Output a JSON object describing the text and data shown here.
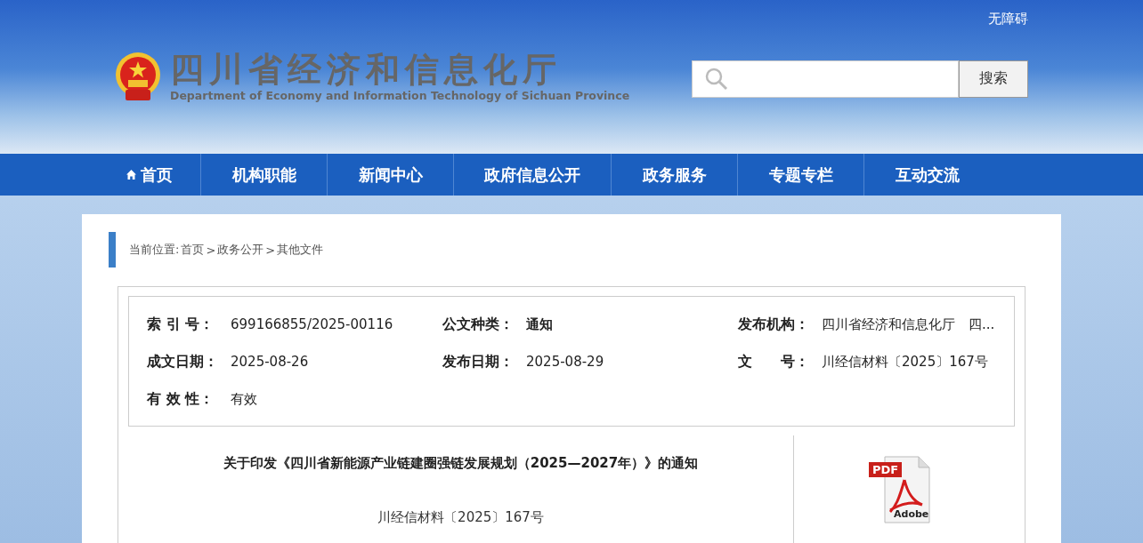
{
  "header": {
    "accessibility_link": "无障碍",
    "site_title": "四川省经济和信息化厅",
    "site_subtitle": "Department of Economy and Information Technology of Sichuan Province",
    "search": {
      "button": "搜索"
    }
  },
  "nav": [
    {
      "label": "首页",
      "kind": "home"
    },
    {
      "label": "机构职能",
      "kind": "plain"
    },
    {
      "label": "新闻中心",
      "kind": "plain"
    },
    {
      "label": "政府信息公开",
      "kind": "plain"
    },
    {
      "label": "政务服务",
      "kind": "plain"
    },
    {
      "label": "专题专栏",
      "kind": "plain"
    },
    {
      "label": "互动交流",
      "kind": "plain"
    }
  ],
  "breadcrumb": {
    "prefix": "当前位置:",
    "items": [
      "首页",
      "政务公开",
      "其他文件"
    ],
    "separator": ">"
  },
  "info": [
    {
      "label": "索 引 号：",
      "value": "699166855/2025-00116"
    },
    {
      "label": "公文种类：",
      "value": "通知",
      "bold": true
    },
    {
      "label": "发布机构：",
      "value": "四川省经济和信息化厅　四..."
    },
    {
      "label": "成文日期：",
      "value": "2025-08-26"
    },
    {
      "label": "发布日期：",
      "value": "2025-08-29"
    },
    {
      "label": "文　　号：",
      "value": "川经信材料〔2025〕167号"
    },
    {
      "label": "有 效 性：",
      "value": "有效"
    }
  ],
  "document": {
    "title": "关于印发《四川省新能源产业链建圈强链发展规划（2025—2027年）》的通知",
    "number": "川经信材料〔2025〕167号"
  },
  "attachment": {
    "badge": "PDF",
    "brand": "Adobe"
  }
}
